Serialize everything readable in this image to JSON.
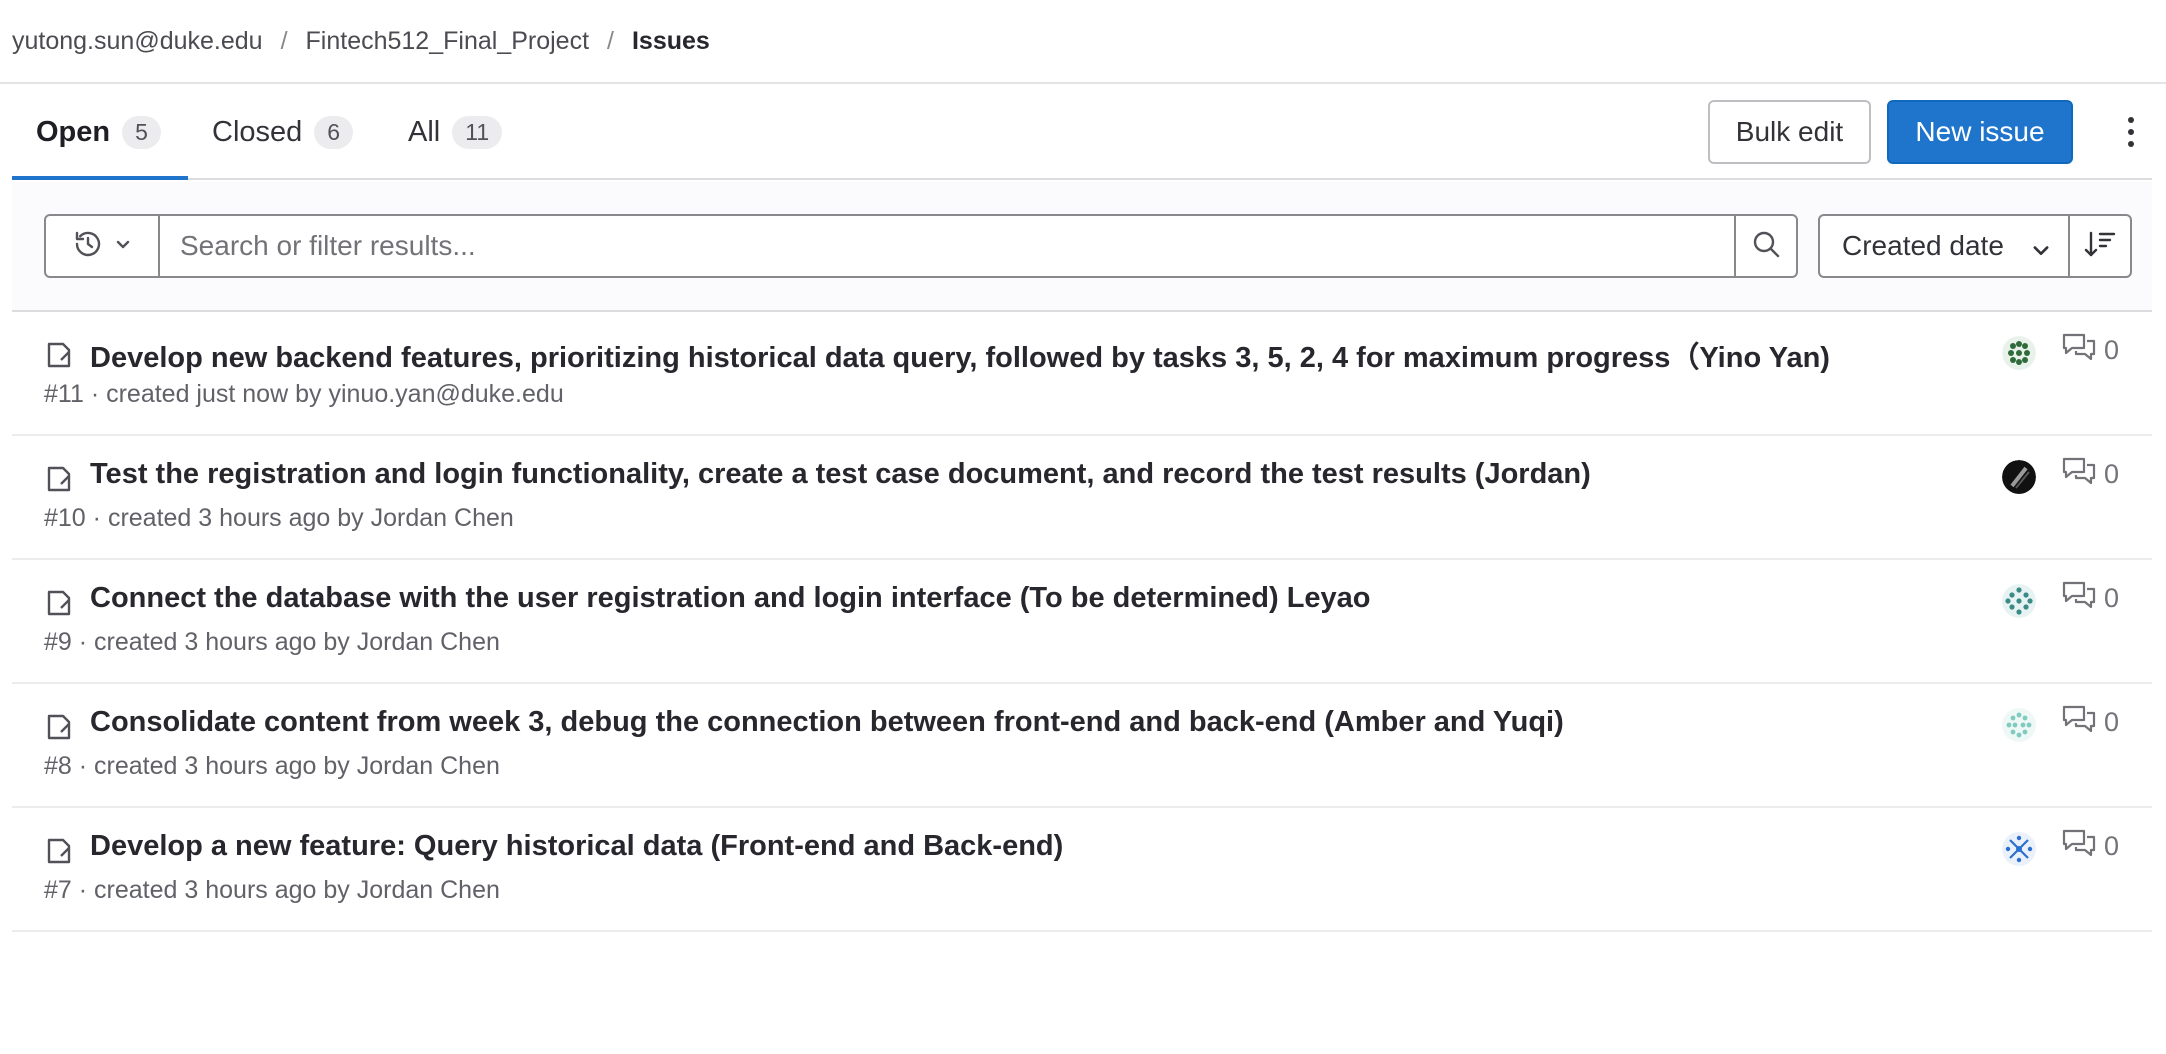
{
  "breadcrumb": {
    "user": "yutong.sun@duke.edu",
    "sep1": "/",
    "project": "Fintech512_Final_Project",
    "sep2": "/",
    "current": "Issues"
  },
  "tabs": [
    {
      "label": "Open",
      "count": "5",
      "active": true
    },
    {
      "label": "Closed",
      "count": "6",
      "active": false
    },
    {
      "label": "All",
      "count": "11",
      "active": false
    }
  ],
  "actions": {
    "bulk_edit": "Bulk edit",
    "new_issue": "New issue"
  },
  "filter": {
    "placeholder": "Search or filter results...",
    "sort_label": "Created date"
  },
  "issues": [
    {
      "title": "Develop new backend features, prioritizing historical data query, followed by tasks 3, 5, 2, 4 for maximum progress（Yino Yan)",
      "ref": "#11",
      "dot": "·",
      "created": "created just now by",
      "author": "yinuo.yan@duke.edu",
      "comments": "0",
      "avatar_color": "#2f6b3a"
    },
    {
      "title": "Test the registration and login functionality, create a test case document, and record the test results (Jordan)",
      "ref": "#10",
      "dot": "·",
      "created": "created 3 hours ago by",
      "author": "Jordan Chen",
      "comments": "0",
      "avatar_color": "#111111"
    },
    {
      "title": "Connect the database with the user registration and login interface (To be determined) Leyao",
      "ref": "#9",
      "dot": "·",
      "created": "created 3 hours ago by",
      "author": "Jordan Chen",
      "comments": "0",
      "avatar_color": "#3b8a86"
    },
    {
      "title": "Consolidate content from week 3, debug the connection between front-end and back-end (Amber and Yuqi)",
      "ref": "#8",
      "dot": "·",
      "created": "created 3 hours ago by",
      "author": "Jordan Chen",
      "comments": "0",
      "avatar_color": "#7fcbbf"
    },
    {
      "title": "Develop a new feature: Query historical data (Front-end and Back-end)",
      "ref": "#7",
      "dot": "·",
      "created": "created 3 hours ago by",
      "author": "Jordan Chen",
      "comments": "0",
      "avatar_color": "#2c6fd0"
    }
  ],
  "colors": {
    "accent": "#1f75cb",
    "text": "#333238",
    "muted": "#626168",
    "border": "#dcdcde"
  },
  "icons": {
    "history": "history-icon",
    "chevron": "chevron-down-icon",
    "search": "search-icon",
    "sort": "sort-descending-icon",
    "issue": "issue-open-icon",
    "comments": "comments-icon",
    "more": "ellipsis-vertical-icon"
  }
}
